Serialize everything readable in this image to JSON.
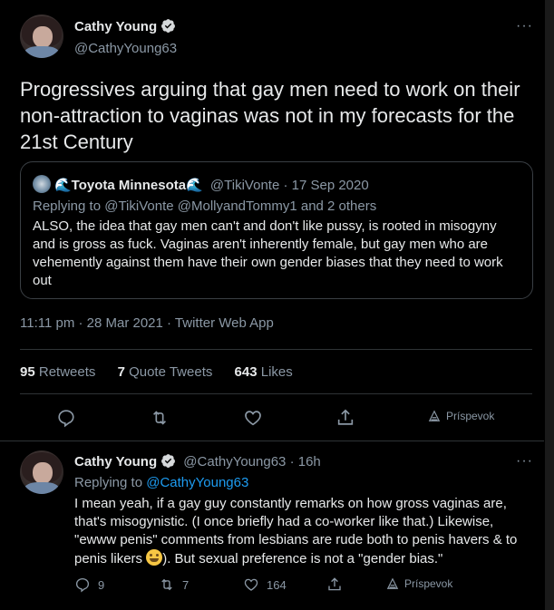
{
  "main_tweet": {
    "author_name": "Cathy Young",
    "author_handle": "@CathyYoung63",
    "text": "Progressives arguing that gay men need to work on their non-attraction to vaginas was not in my forecasts for the 21st Century",
    "quote": {
      "author_name": "🌊Toyota Minnesota🌊",
      "author_handle": "@TikiVonte",
      "date": "· 17 Sep 2020",
      "replying_to": "Replying to @TikiVonte @MollyandTommy1  and 2 others",
      "text": "ALSO, the idea that gay men can't and don't like pussy, is rooted in misogyny and is gross as fuck. Vaginas aren't inherently female, but gay men who are vehemently against them have their own gender biases that they need to work out"
    },
    "timestamp": "11:11 pm · 28 Mar 2021 · Twitter Web App",
    "stats": {
      "retweets_count": "95",
      "retweets_label": "Retweets",
      "quotes_count": "7",
      "quotes_label": "Quote Tweets",
      "likes_count": "643",
      "likes_label": "Likes"
    },
    "actions": {
      "share_label": "Príspevok"
    }
  },
  "reply_tweet": {
    "author_name": "Cathy Young",
    "author_handle": "@CathyYoung63",
    "time": "· 16h",
    "replying_prefix": "Replying to",
    "replying_handle": "@CathyYoung63",
    "text_part1": "I mean yeah, if a gay guy constantly remarks on how gross vaginas are, that's misogynistic. (I once briefly had a co-worker like that.) Likewise, \"ewww penis\" comments from lesbians are rude both to penis havers & to penis likers ",
    "text_part2": "). But sexual preference is not a \"gender bias.\"",
    "reply_count": "9",
    "retweet_count": "7",
    "like_count": "164",
    "share_label": "Príspevok"
  },
  "colors": {
    "background": "#000000",
    "primary_text": "#e7e9ea",
    "secondary_text": "#8b98a5",
    "link": "#1d9bf0",
    "verified": "#d6d9db"
  },
  "icons": [
    "verified-badge-icon",
    "more-icon",
    "reply-icon",
    "retweet-icon",
    "like-icon",
    "share-icon",
    "prispevok-icon",
    "grinning-emoji-icon"
  ]
}
